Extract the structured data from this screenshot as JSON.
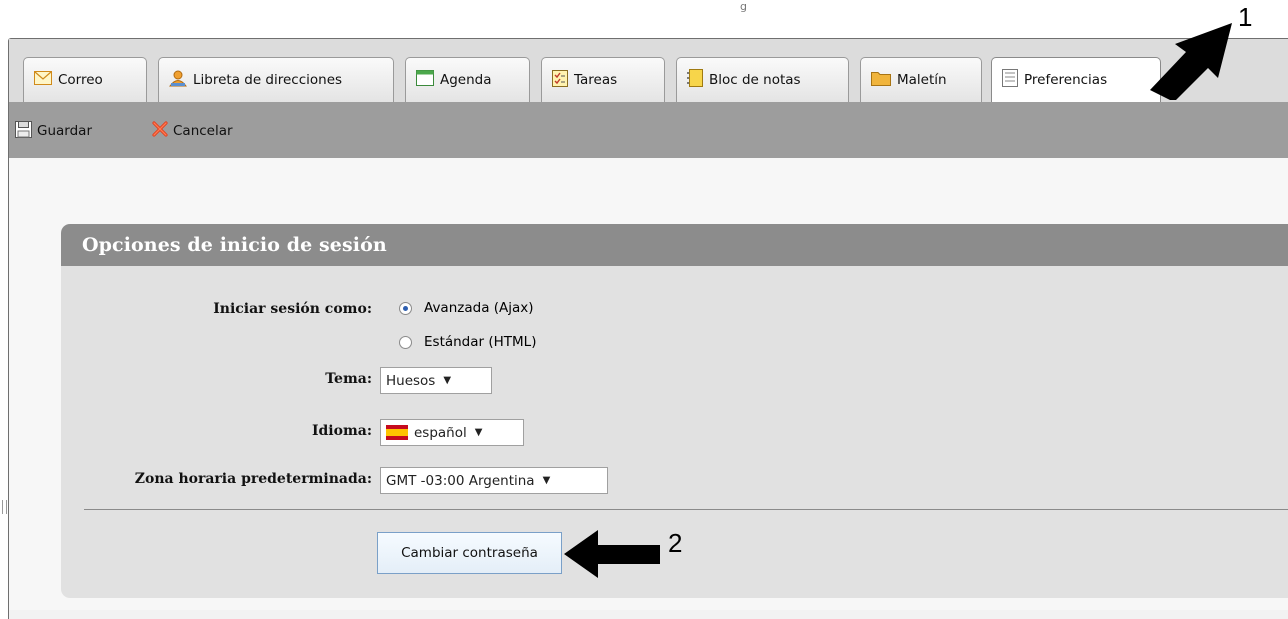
{
  "tabs": [
    {
      "label": "Correo",
      "icon": "mail-icon"
    },
    {
      "label": "Libreta de direcciones",
      "icon": "contacts-icon"
    },
    {
      "label": "Agenda",
      "icon": "calendar-icon"
    },
    {
      "label": "Tareas",
      "icon": "tasks-icon"
    },
    {
      "label": "Bloc de notas",
      "icon": "notebook-icon"
    },
    {
      "label": "Maletín",
      "icon": "briefcase-icon"
    },
    {
      "label": "Preferencias",
      "icon": "preferences-icon",
      "active": true
    }
  ],
  "toolbar": {
    "save_label": "Guardar",
    "cancel_label": "Cancelar"
  },
  "panel": {
    "title": "Opciones de inicio de sesión",
    "login_label": "Iniciar sesión como:",
    "login_options": [
      "Avanzada (Ajax)",
      "Estándar (HTML)"
    ],
    "login_selected": "Avanzada (Ajax)",
    "theme_label": "Tema:",
    "theme_value": "Huesos",
    "language_label": "Idioma:",
    "language_value": "español",
    "timezone_label": "Zona horaria predeterminada:",
    "timezone_value": "GMT -03:00 Argentina",
    "change_password_label": "Cambiar contraseña"
  },
  "annotations": {
    "marker1": "1",
    "marker2": "2"
  },
  "colors": {
    "toolbar": "#9d9d9d",
    "panel_header": "#8c8c8c",
    "panel_body": "#e1e1e1",
    "radio_selected": "#2e5fb0"
  }
}
